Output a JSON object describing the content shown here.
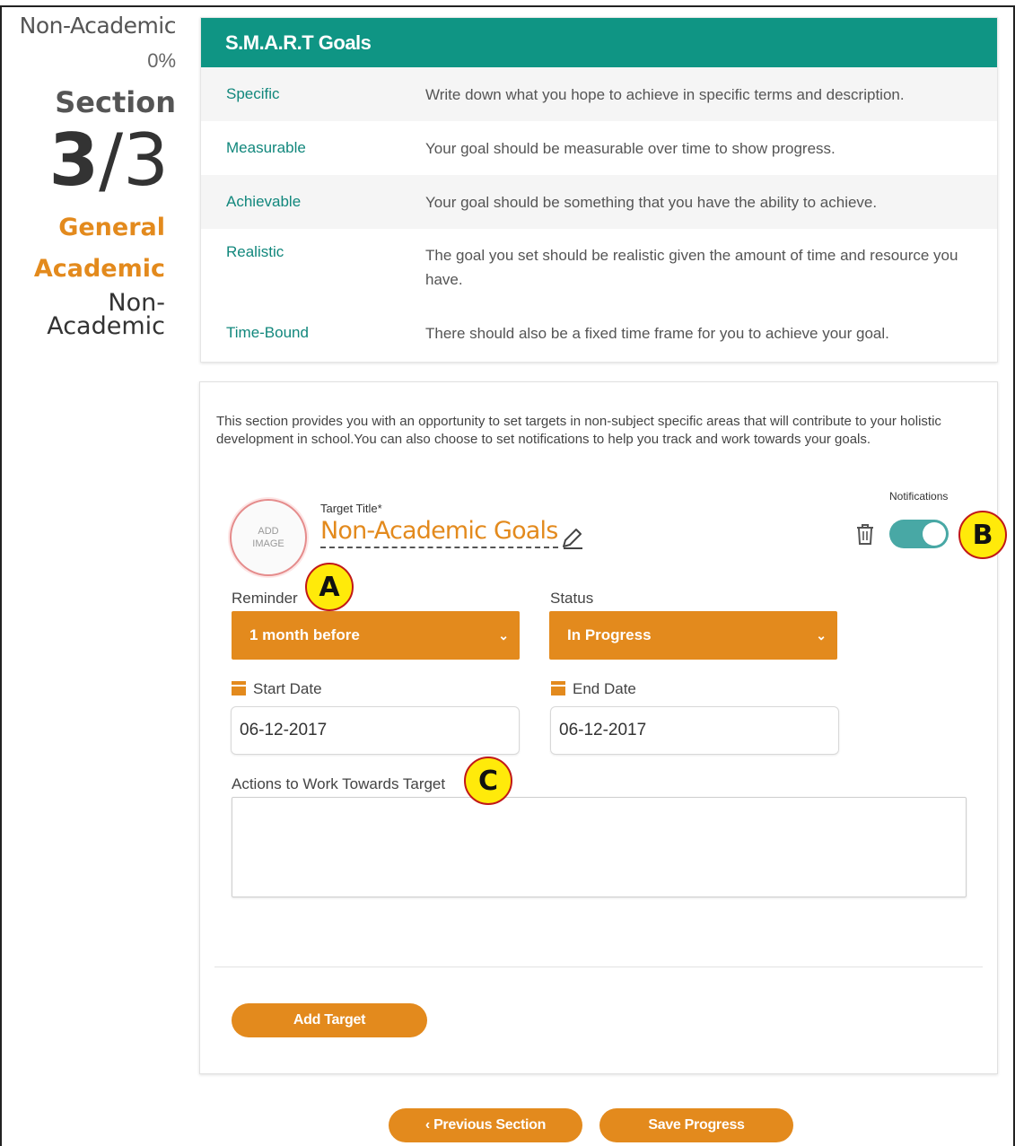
{
  "sidebar": {
    "top_label": "Non-Academic",
    "percent": "0%",
    "section_label": "Section",
    "current": "3",
    "slash": "/",
    "total": "3",
    "nav": [
      {
        "label": "General"
      },
      {
        "label": "Academic"
      },
      {
        "label": "Non-\nAcademic"
      }
    ]
  },
  "smart": {
    "title": "S.M.A.R.T Goals",
    "rows": [
      {
        "term": "Specific",
        "desc": "Write down what you hope to achieve in specific terms and description."
      },
      {
        "term": "Measurable",
        "desc": "Your goal should be measurable over time to show progress."
      },
      {
        "term": "Achievable",
        "desc": "Your goal should be something that you have the ability to achieve."
      },
      {
        "term": "Realistic",
        "desc": "The goal you set should be realistic given the amount of time and resource you have."
      },
      {
        "term": "Time-Bound",
        "desc": "There should also be a fixed time frame for you to achieve your goal."
      }
    ]
  },
  "form": {
    "intro": "This section provides you with an opportunity to set targets in non-subject specific areas that will contribute to your holistic development in school.You can also choose to set notifications to help you track and work towards your goals.",
    "add_image": "ADD IMAGE",
    "target_title_label": "Target Title*",
    "target_title_value": "Non-Academic Goals",
    "notifications_label": "Notifications",
    "notifications_on": true,
    "reminder_label": "Reminder",
    "reminder_value": "1 month before",
    "status_label": "Status",
    "status_value": "In Progress",
    "start_date_label": "Start Date",
    "start_date_value": "06-12-2017",
    "end_date_label": "End Date",
    "end_date_value": "06-12-2017",
    "actions_label": "Actions to Work Towards Target",
    "actions_value": "",
    "add_target_label": "Add Target"
  },
  "footer": {
    "previous_label": "‹ Previous Section",
    "save_label": "Save Progress"
  },
  "markers": {
    "a": "A",
    "b": "B",
    "c": "C"
  },
  "colors": {
    "accent": "#e38a1d",
    "teal": "#0f9584",
    "toggle": "#48a8a5",
    "marker": "#ffea0a"
  }
}
